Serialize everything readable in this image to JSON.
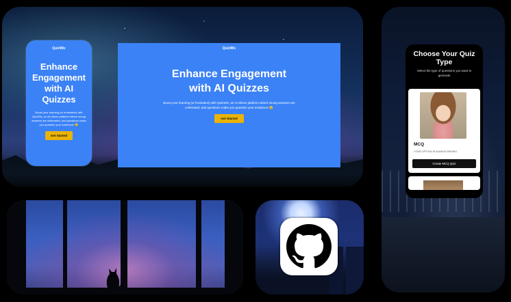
{
  "hero": {
    "mobile": {
      "brand": "QuizWiz",
      "title": "Enhance Engagement with AI Quizzes",
      "description": "Boost your learning (or frustration) with QuizWiz, an AI-driven platform where wrong answers are celebrated, and questions make you question your existence! 😉",
      "button": "Get Started"
    },
    "desktop": {
      "brand": "QuizWiz",
      "title": "Enhance Engagement with AI Quizzes",
      "description": "Boost your learning (or frustration) with QuizWiz, an AI-driven platform where wrong answers are celebrated, and questions make you question your existence! 😉",
      "button": "Get Started"
    }
  },
  "quiz_type": {
    "title": "Choose Your Quiz Type",
    "subtitle": "Select the type of questions you want to generate",
    "cards": [
      {
        "name": "MCQ",
        "description": "YOUR OPTION IS ALWAYS WRONG",
        "button": "Create MCQ Quiz"
      }
    ]
  },
  "icons": {
    "github": "github-icon"
  },
  "colors": {
    "accent_blue": "#3b82f6",
    "button_yellow": "#eab308",
    "background": "#000000"
  }
}
